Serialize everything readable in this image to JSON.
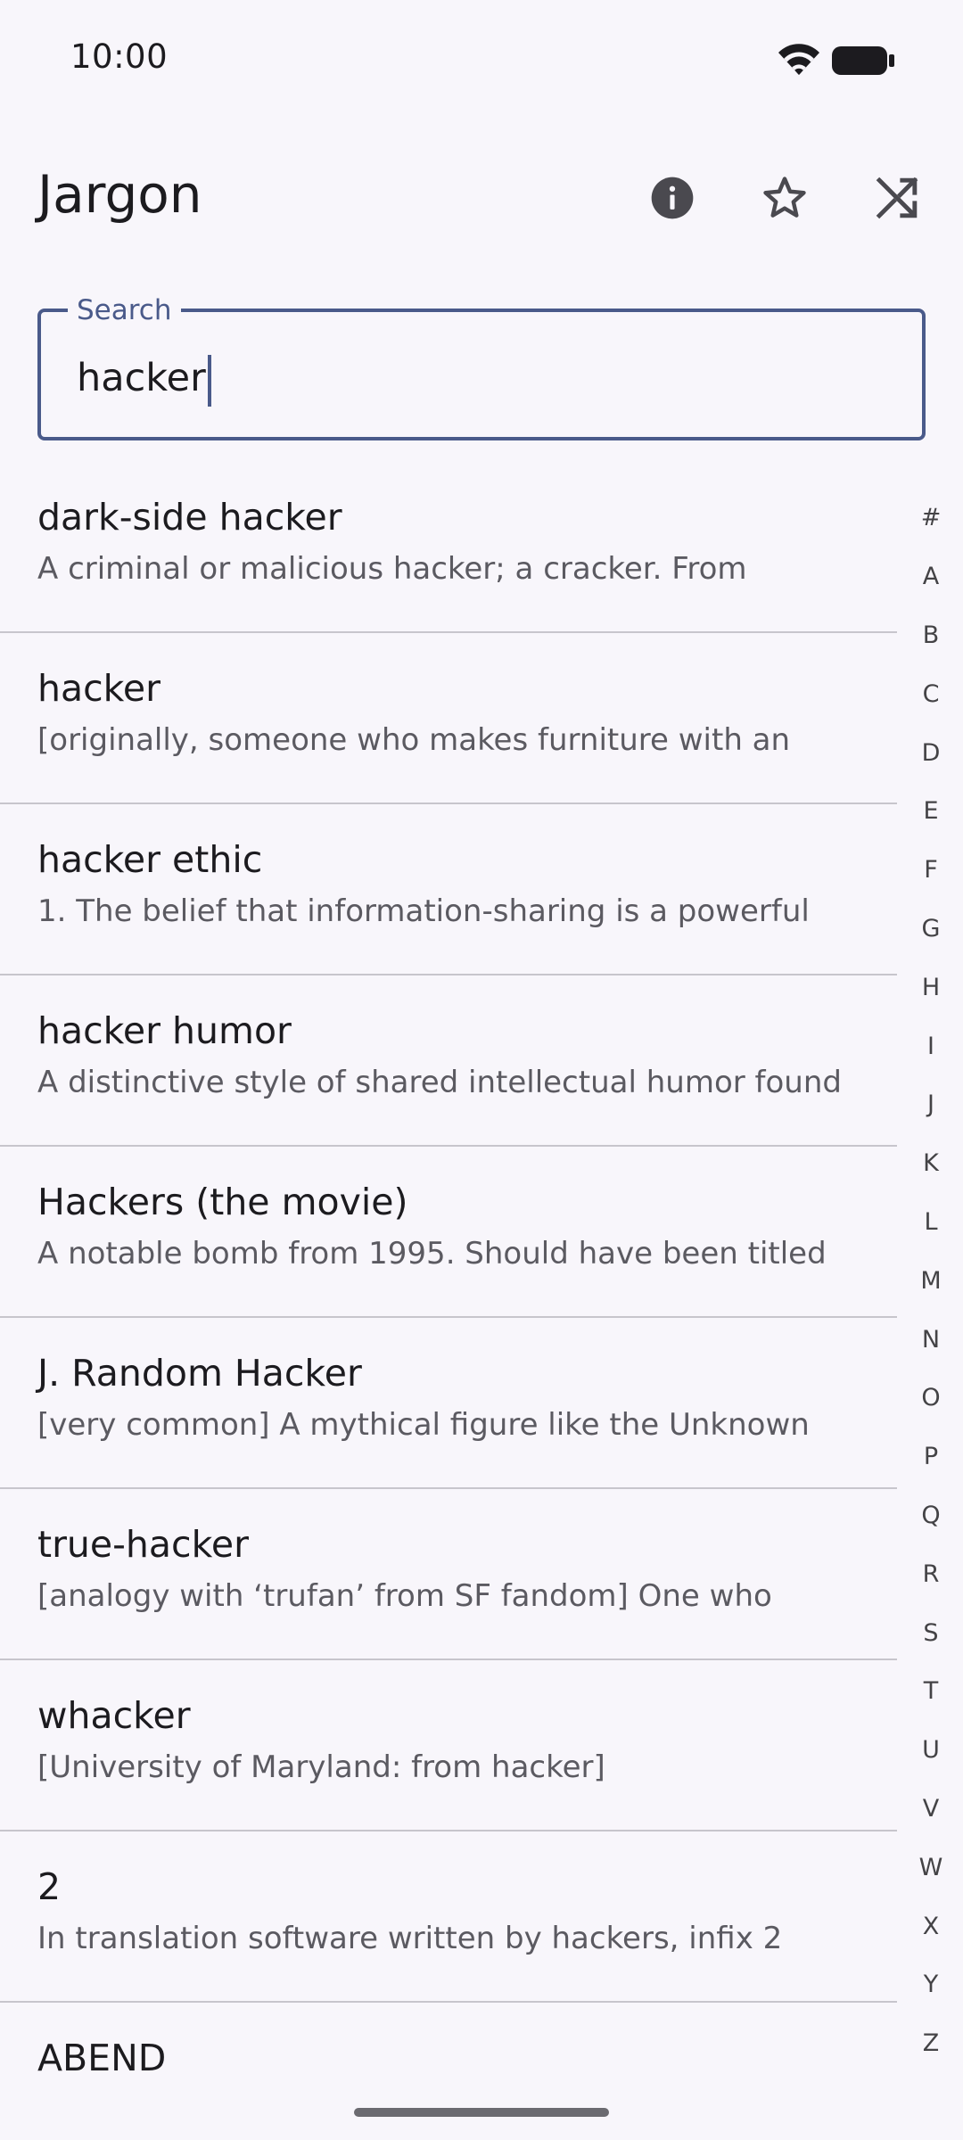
{
  "status_bar": {
    "time": "10:00",
    "wifi_icon": "wifi-icon",
    "battery_icon": "battery-icon"
  },
  "app_bar": {
    "title": "Jargon",
    "actions": [
      {
        "name": "info",
        "icon": "info-icon"
      },
      {
        "name": "favorites",
        "icon": "star-outline-icon"
      },
      {
        "name": "random",
        "icon": "shuffle-icon"
      }
    ]
  },
  "search": {
    "label": "Search",
    "value": "hacker"
  },
  "results": [
    {
      "title": "dark-side hacker",
      "desc": "A criminal or malicious hacker; a cracker. From"
    },
    {
      "title": "hacker",
      "desc": "[originally, someone who makes furniture with an"
    },
    {
      "title": "hacker ethic",
      "desc": "1. The belief that information-sharing is a powerful"
    },
    {
      "title": "hacker humor",
      "desc": "A distinctive style of shared intellectual humor found"
    },
    {
      "title": "Hackers (the movie)",
      "desc": "A notable bomb from 1995. Should have been titled"
    },
    {
      "title": "J. Random Hacker",
      "desc": "[very common] A mythical figure like the Unknown"
    },
    {
      "title": "true-hacker",
      "desc": "[analogy with ‘trufan’ from SF fandom] One who"
    },
    {
      "title": "whacker",
      "desc": "[University of Maryland: from hacker]"
    },
    {
      "title": "2",
      "desc": "In translation software written by hackers, infix 2"
    },
    {
      "title": "ABEND",
      "desc": ""
    }
  ],
  "alphabet_index": [
    "#",
    "A",
    "B",
    "C",
    "D",
    "E",
    "F",
    "G",
    "H",
    "I",
    "J",
    "K",
    "L",
    "M",
    "N",
    "O",
    "P",
    "Q",
    "R",
    "S",
    "T",
    "U",
    "V",
    "W",
    "X",
    "Y",
    "Z"
  ],
  "colors": {
    "background": "#f8f6fb",
    "accent": "#4a5a8a",
    "divider": "#c7c5cc",
    "text_primary": "#1c1b1f",
    "text_secondary": "#5b5a61"
  }
}
